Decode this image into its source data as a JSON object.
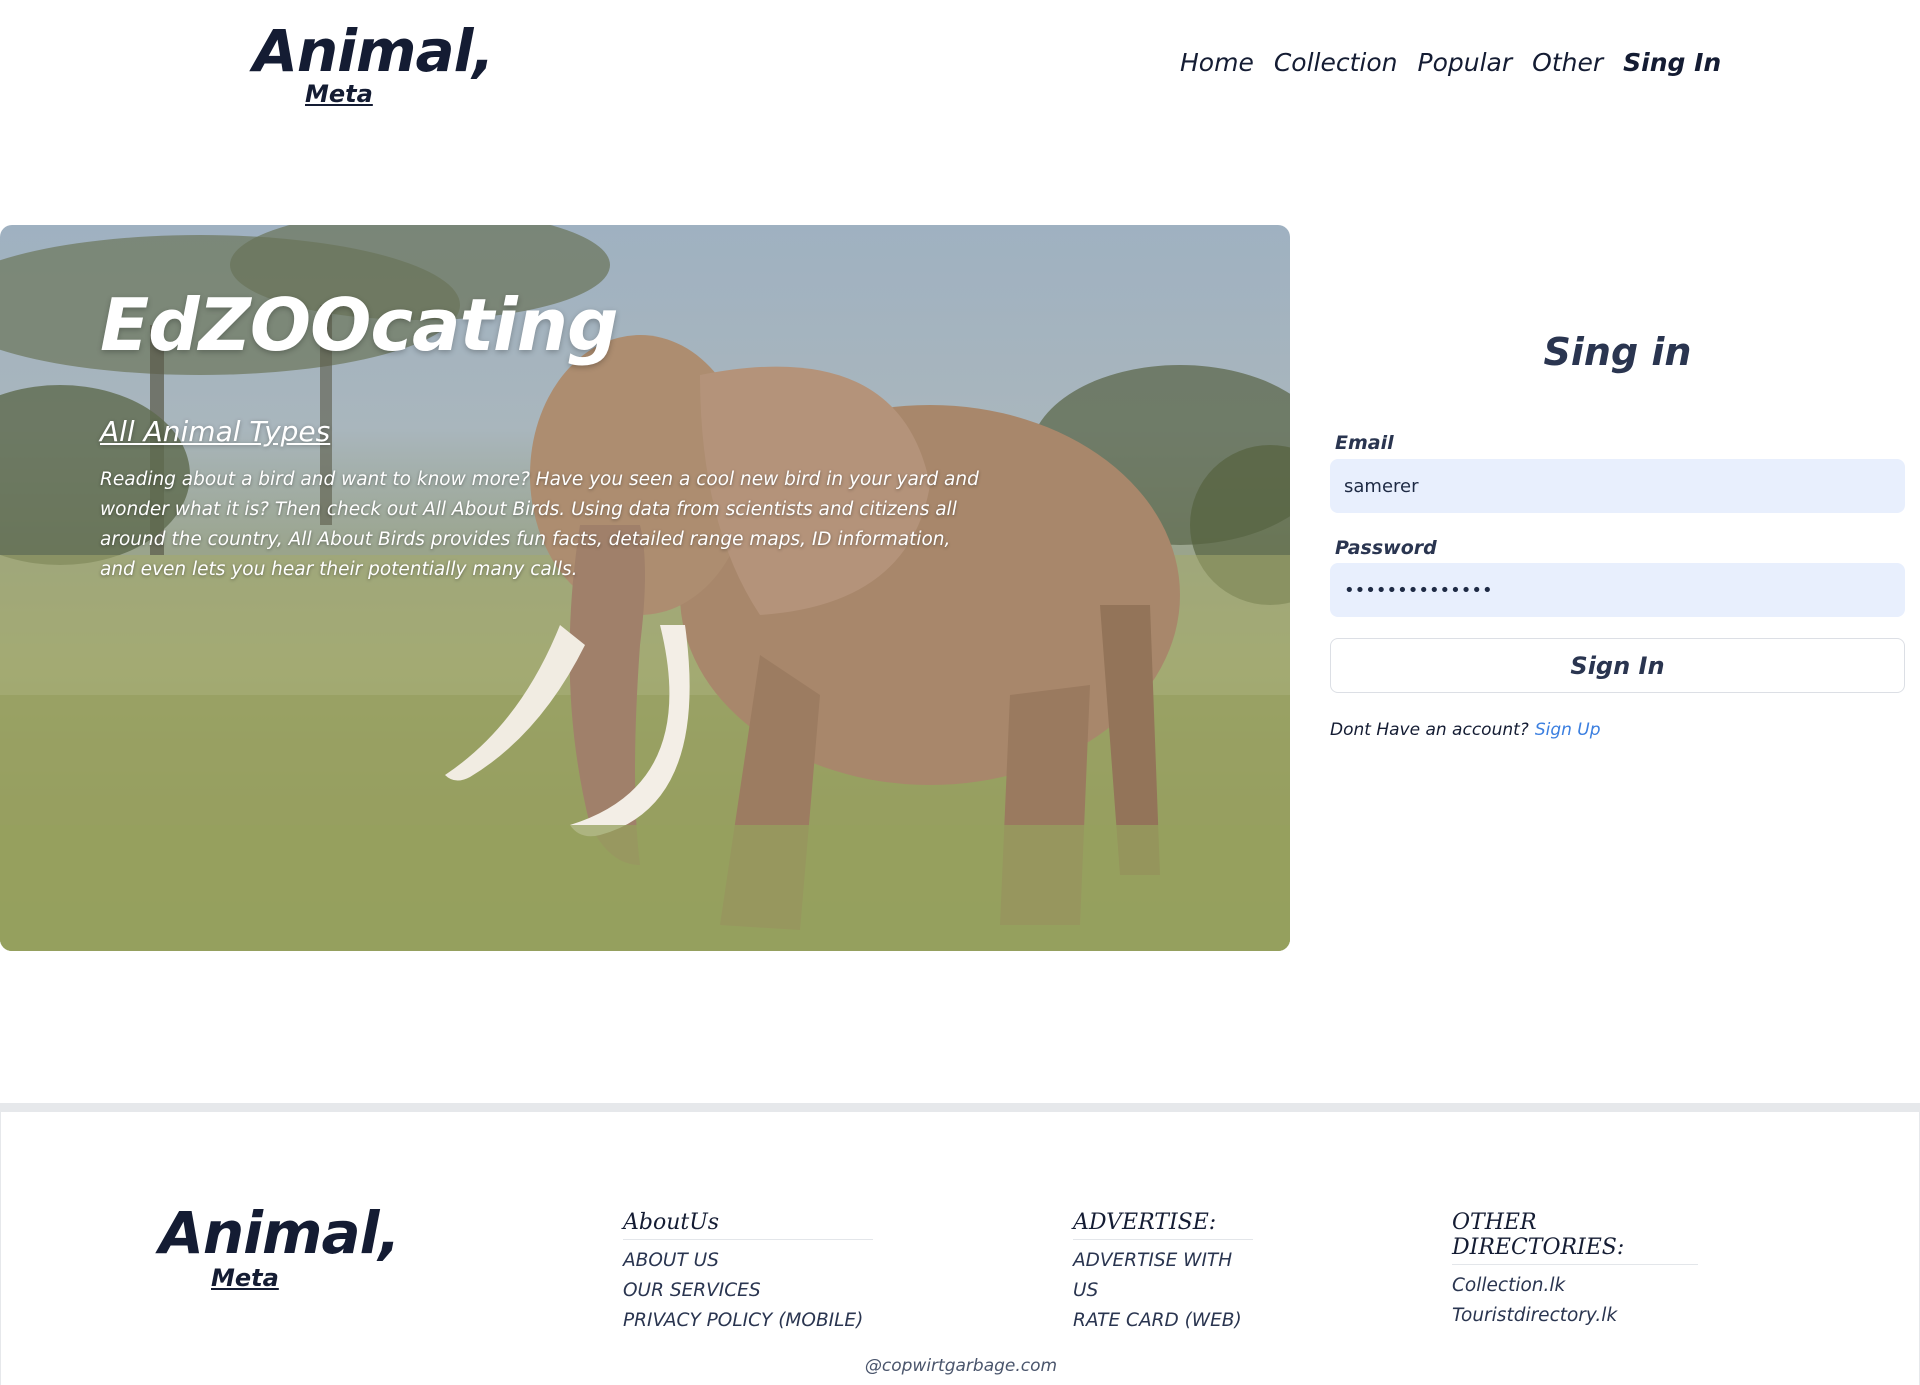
{
  "brand": {
    "main": "Animal,",
    "sub": "Meta"
  },
  "nav": {
    "items": [
      {
        "label": "Home"
      },
      {
        "label": "Collection"
      },
      {
        "label": "Popular"
      },
      {
        "label": "Other"
      },
      {
        "label": "Sing In"
      }
    ]
  },
  "hero": {
    "title": "EdZOOcating",
    "subtitle": "All Animal Types",
    "text": "Reading about a bird and want to know more? Have you seen a cool new bird in your yard and wonder what it is? Then check out All About Birds. Using data from scientists and citizens all around the country, All About Birds provides fun facts, detailed range maps, ID information, and even lets you hear their potentially many calls."
  },
  "signin": {
    "title": "Sing in",
    "email_label": "Email",
    "email_value": "samerer",
    "password_label": "Password",
    "password_value": "••••••••••••••",
    "button_label": "Sign In",
    "no_account_text": "Dont Have an account?",
    "signup_link": "Sign Up"
  },
  "footer": {
    "about": {
      "heading": "AboutUs",
      "links": [
        "ABOUT US",
        "OUR SERVICES",
        "PRIVACY POLICY (MOBILE)"
      ]
    },
    "advertise": {
      "heading": "ADVERTISE:",
      "links": [
        "ADVERTISE WITH US",
        "RATE CARD (WEB)"
      ]
    },
    "directories": {
      "heading": "OTHER DIRECTORIES:",
      "links": [
        "Collection.lk",
        "Touristdirectory.lk"
      ]
    },
    "copyright": "@copwirtgarbage.com"
  },
  "colors": {
    "brand_dark": "#141c33",
    "input_bg": "#e8effd",
    "link_blue": "#3b7fe0"
  }
}
